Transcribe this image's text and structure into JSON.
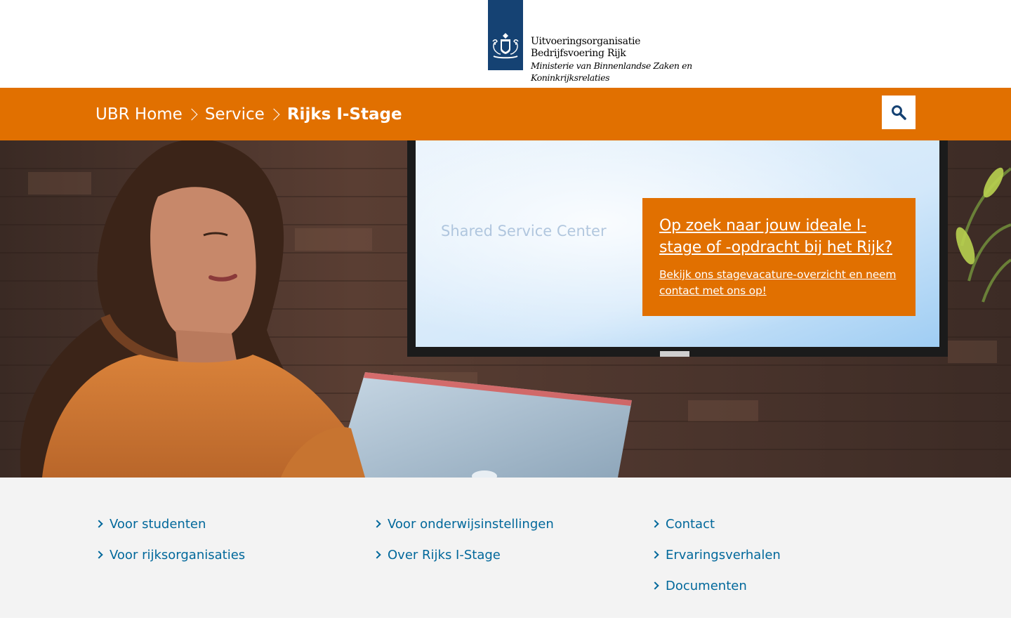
{
  "header": {
    "org_line1": "Uitvoeringsorganisatie",
    "org_line2": "Bedrijfsvoering Rijk",
    "ministry_line1": "Ministerie van Binnenlandse Zaken en",
    "ministry_line2": "Koninkrijksrelaties"
  },
  "breadcrumb": {
    "items": [
      "UBR Home",
      "Service",
      "Rijks I-Stage"
    ]
  },
  "search": {
    "label": "Zoeken"
  },
  "hero": {
    "screen_text": "Shared Service Center",
    "callout_title": "Op zoek naar jouw ideale I-stage of -opdracht bij het Rijk?",
    "callout_text": "Bekijk ons stagevacature-overzicht en neem contact met ons op!"
  },
  "links": {
    "col1": [
      "Voor studenten",
      "Voor rijksorganisaties"
    ],
    "col2": [
      "Voor onderwijsinstellingen",
      "Over Rijks I-Stage"
    ],
    "col3": [
      "Contact",
      "Ervaringsverhalen",
      "Documenten"
    ]
  },
  "colors": {
    "brand_orange": "#e17000",
    "logo_blue": "#154273",
    "link_blue": "#01689b",
    "footer_grey": "#f3f3f3"
  },
  "icons": {
    "logo": "dutch-coat-of-arms-icon",
    "search": "magnifier-icon",
    "breadcrumb_separator": "chevron-right-icon",
    "link_marker": "chevron-right-icon"
  }
}
